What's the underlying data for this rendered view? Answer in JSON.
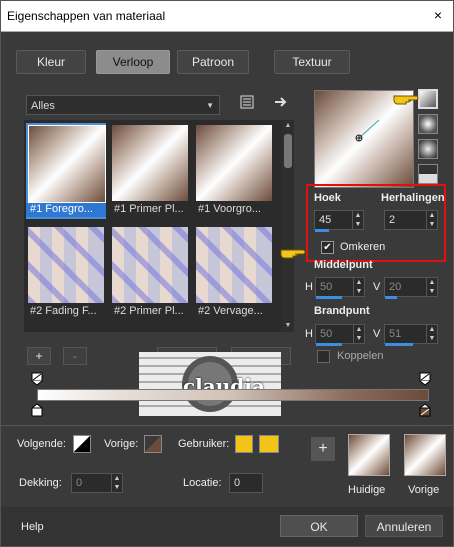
{
  "window": {
    "title": "Eigenschappen van materiaal",
    "close": "×"
  },
  "tabs": [
    {
      "label": "Kleur",
      "active": false
    },
    {
      "label": "Verloop",
      "active": true
    },
    {
      "label": "Patroon",
      "active": false
    },
    {
      "label": "Textuur",
      "active": false
    }
  ],
  "category": {
    "value": "Alles"
  },
  "gallery": {
    "items": [
      {
        "caption": "#1 Foregro...",
        "selected": true
      },
      {
        "caption": "#1 Primer Pl...",
        "selected": false
      },
      {
        "caption": "#1 Voorgro...",
        "selected": false
      },
      {
        "caption": "#2 Fading F...",
        "selected": false
      },
      {
        "caption": "#2 Primer Pl...",
        "selected": false
      },
      {
        "caption": "#2 Vervage...",
        "selected": false
      }
    ]
  },
  "controls": {
    "hoek_label": "Hoek",
    "hoek_value": "45",
    "herhalingen_label": "Herhalingen",
    "herhalingen_value": "2",
    "omkeren_label": "Omkeren",
    "omkeren_checked": true,
    "middelpunt_label": "Middelpunt",
    "h_label": "H",
    "v_label": "V",
    "mid_h": "50",
    "mid_v": "20",
    "brandpunt_label": "Brandpunt",
    "brand_h": "50",
    "brand_v": "51",
    "koppelen_label": "Koppelen",
    "koppelen_checked": false
  },
  "stops": {
    "add": "+",
    "remove": "-"
  },
  "bottom": {
    "volgende_label": "Volgende:",
    "vorige_label": "Vorige:",
    "gebruiker_label": "Gebruiker:",
    "dekking_label": "Dekking:",
    "dekking_value": "0",
    "locatie_label": "Locatie:",
    "locatie_value": "0",
    "add_button": "+",
    "huidige_label": "Huidige",
    "vorige_swatch_label": "Vorige",
    "user_color": "#f2c318"
  },
  "footer": {
    "help": "Help",
    "ok": "OK",
    "cancel": "Annuleren"
  },
  "watermark": {
    "text": "claudia"
  }
}
